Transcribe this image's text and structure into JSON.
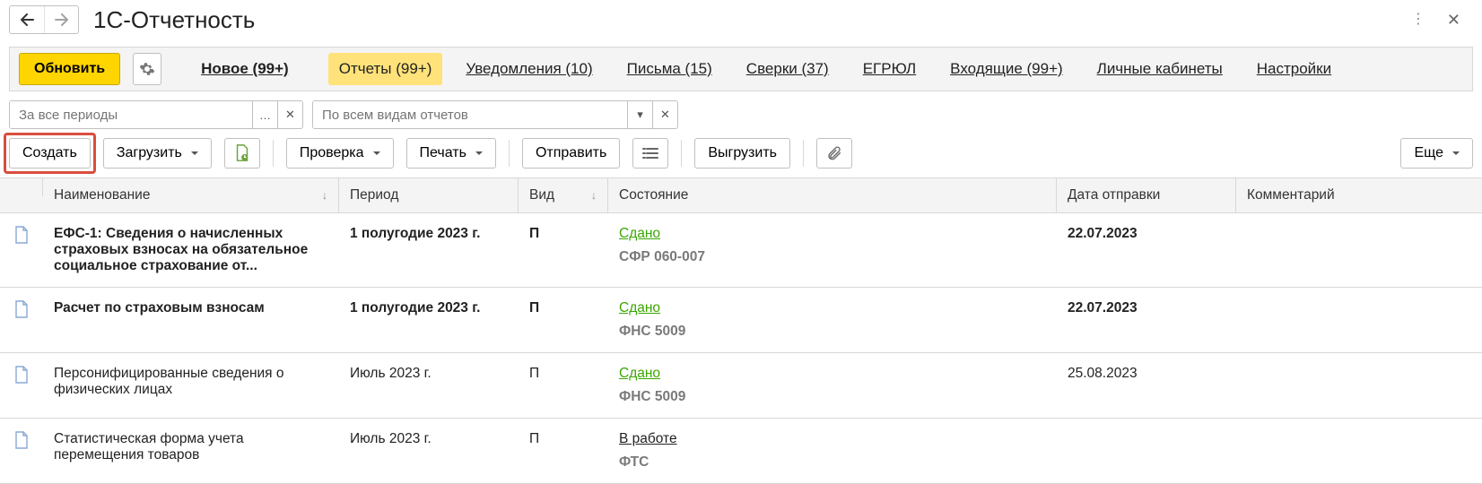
{
  "header": {
    "title": "1С-Отчетность"
  },
  "tabs": {
    "refresh_label": "Обновить",
    "new_label": "Новое (99+)",
    "items": [
      {
        "label": "Отчеты (99+)",
        "active": true
      },
      {
        "label": "Уведомления (10)"
      },
      {
        "label": "Письма (15)"
      },
      {
        "label": "Сверки (37)"
      },
      {
        "label": "ЕГРЮЛ"
      },
      {
        "label": "Входящие (99+)"
      },
      {
        "label": "Личные кабинеты"
      },
      {
        "label": "Настройки"
      }
    ]
  },
  "filters": {
    "period_placeholder": "За все периоды",
    "report_type_placeholder": "По всем видам отчетов"
  },
  "toolbar": {
    "create_label": "Создать",
    "load_label": "Загрузить",
    "check_label": "Проверка",
    "print_label": "Печать",
    "send_label": "Отправить",
    "export_label": "Выгрузить",
    "more_label": "Еще"
  },
  "columns": {
    "name": "Наименование",
    "period": "Период",
    "kind": "Вид",
    "state": "Состояние",
    "sent_date": "Дата отправки",
    "comment": "Комментарий"
  },
  "rows": [
    {
      "name": "ЕФС-1: Сведения о начисленных страховых взносах на обязательное социальное страхование от...",
      "period": "1 полугодие 2023 г.",
      "kind": "П",
      "status": "Сдано",
      "status_style": "green",
      "status_sub": "СФР 060-007",
      "sent_date": "22.07.2023",
      "bold": true
    },
    {
      "name": "Расчет по страховым взносам",
      "period": "1 полугодие 2023 г.",
      "kind": "П",
      "status": "Сдано",
      "status_style": "green",
      "status_sub": "ФНС 5009",
      "sent_date": "22.07.2023",
      "bold": true
    },
    {
      "name": "Персонифицированные сведения о физических лицах",
      "period": "Июль 2023 г.",
      "kind": "П",
      "status": "Сдано",
      "status_style": "green",
      "status_sub": "ФНС 5009",
      "sent_date": "25.08.2023",
      "bold": false
    },
    {
      "name": "Статистическая форма учета перемещения товаров",
      "period": "Июль 2023 г.",
      "kind": "П",
      "status": "В работе",
      "status_style": "link",
      "status_sub": "ФТС",
      "sent_date": "",
      "bold": false
    }
  ]
}
